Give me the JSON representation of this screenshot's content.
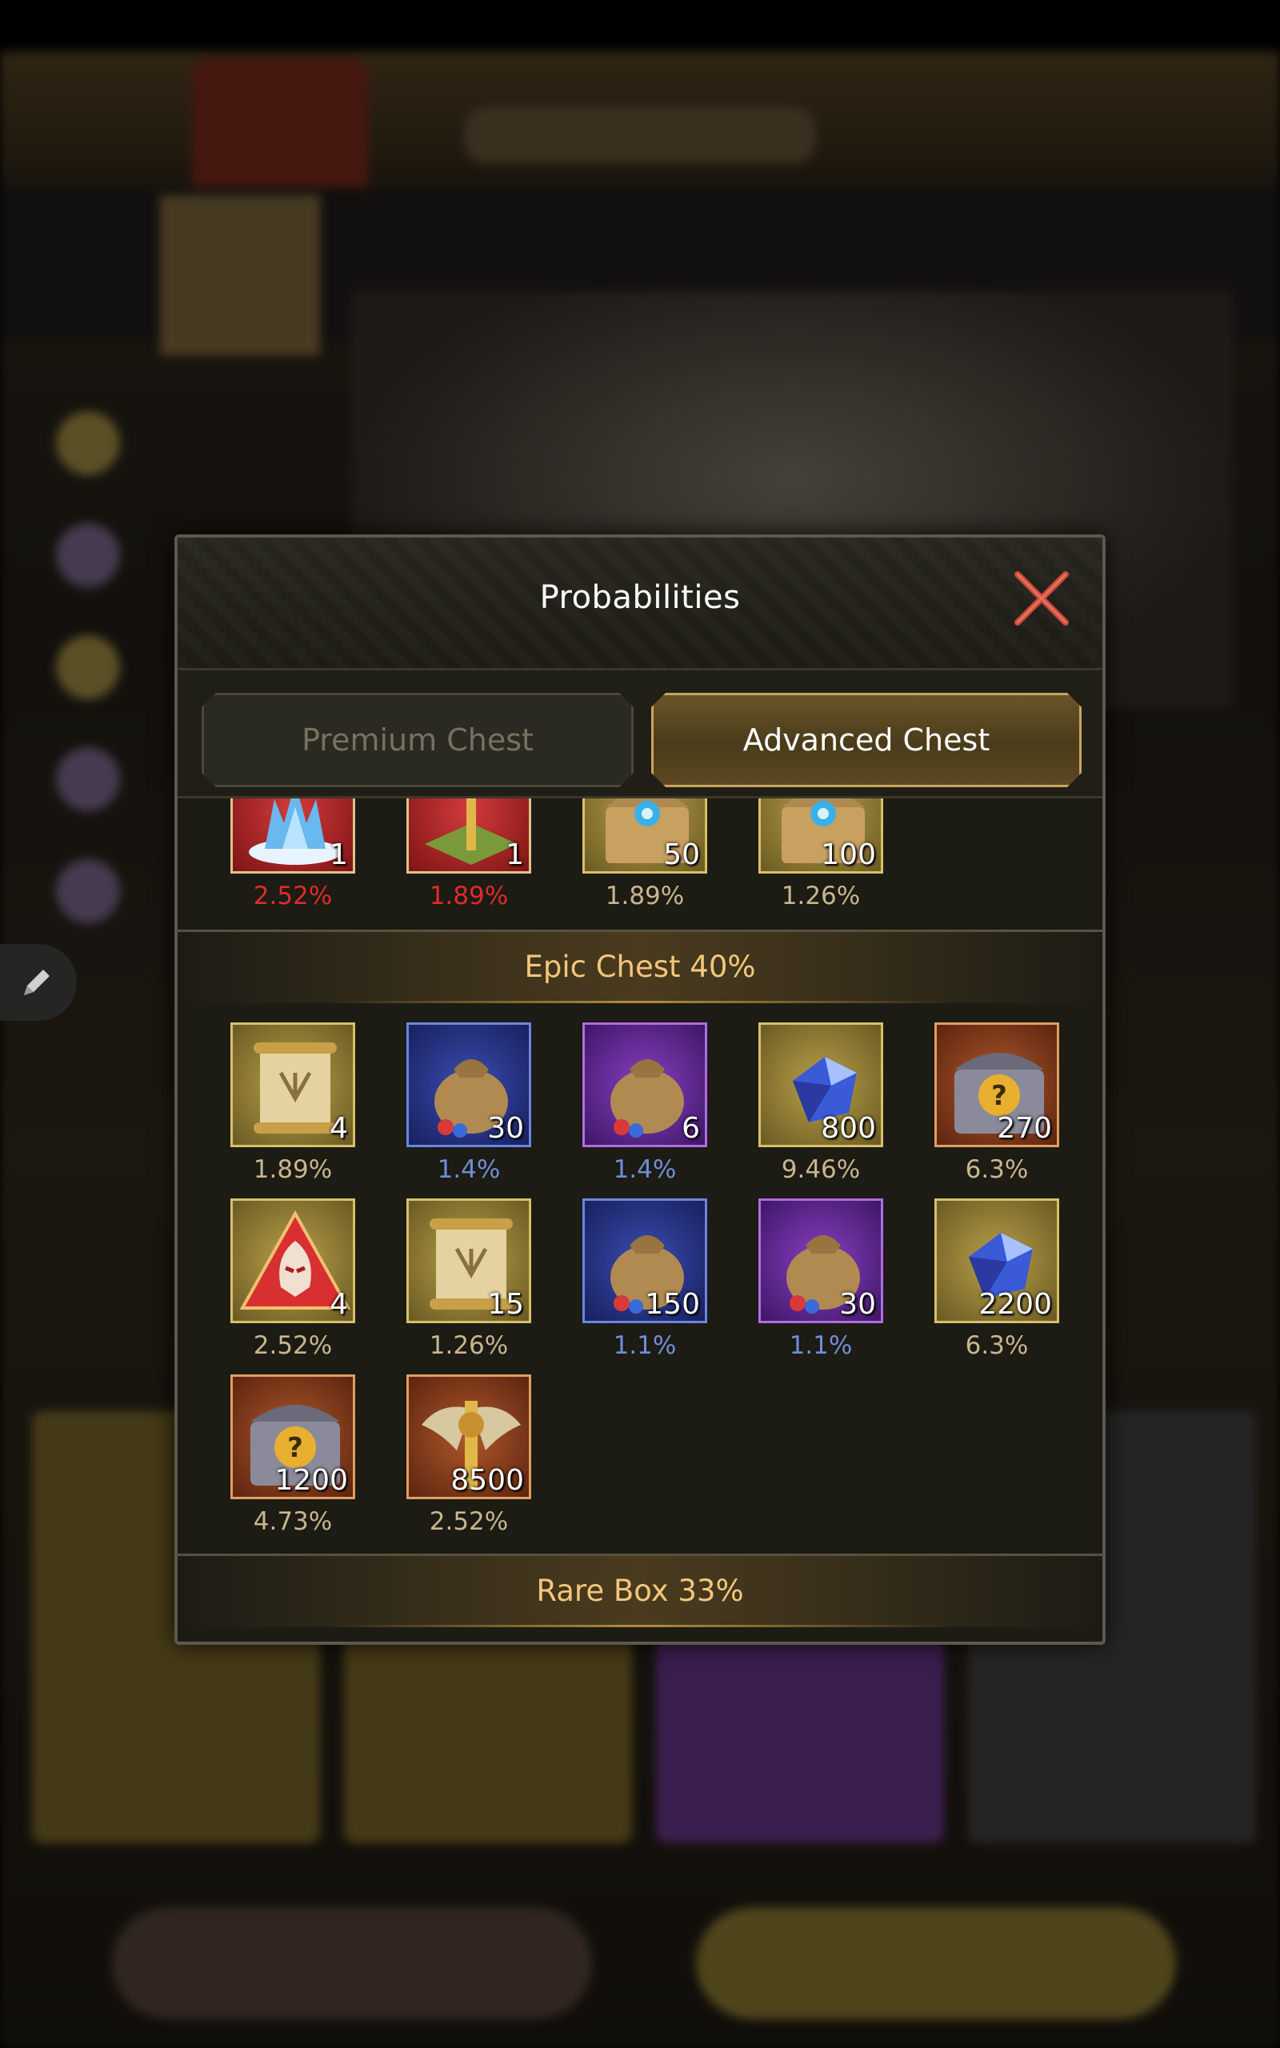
{
  "dialog": {
    "title": "Probabilities",
    "tabs": {
      "premium": "Premium Chest",
      "advanced": "Advanced Chest"
    },
    "active_tab": "advanced"
  },
  "top_row": [
    {
      "icon": "crystal-castle-icon",
      "qty": "1",
      "pct": "2.52%",
      "frame": "red",
      "pct_color": "#e02a2a"
    },
    {
      "icon": "golden-spire-icon",
      "qty": "1",
      "pct": "1.89%",
      "frame": "red",
      "pct_color": "#e02a2a"
    },
    {
      "icon": "treasure-chest-icon",
      "qty": "50",
      "pct": "1.89%",
      "frame": "gold",
      "pct_color": "#c9b58e"
    },
    {
      "icon": "treasure-chest-icon",
      "qty": "100",
      "pct": "1.26%",
      "frame": "gold",
      "pct_color": "#c9b58e"
    }
  ],
  "epic": {
    "title": "Epic Chest 40%",
    "items": [
      {
        "icon": "scroll-icon",
        "qty": "4",
        "pct": "1.89%",
        "frame": "gold"
      },
      {
        "icon": "resource-bag-icon",
        "qty": "30",
        "pct": "1.4%",
        "frame": "blue"
      },
      {
        "icon": "resource-bag-icon",
        "qty": "6",
        "pct": "1.4%",
        "frame": "purple"
      },
      {
        "icon": "blue-crystal-icon",
        "qty": "800",
        "pct": "9.46%",
        "frame": "gold"
      },
      {
        "icon": "mystery-chest-icon",
        "qty": "270",
        "pct": "6.3%",
        "frame": "orange"
      },
      {
        "icon": "red-mask-icon",
        "qty": "4",
        "pct": "2.52%",
        "frame": "gold"
      },
      {
        "icon": "scroll-icon",
        "qty": "15",
        "pct": "1.26%",
        "frame": "gold"
      },
      {
        "icon": "resource-bag-icon",
        "qty": "150",
        "pct": "1.1%",
        "frame": "blue"
      },
      {
        "icon": "resource-bag-icon",
        "qty": "30",
        "pct": "1.1%",
        "frame": "purple"
      },
      {
        "icon": "blue-crystal-icon",
        "qty": "2200",
        "pct": "6.3%",
        "frame": "gold"
      },
      {
        "icon": "mystery-chest-icon",
        "qty": "1200",
        "pct": "4.73%",
        "frame": "orange"
      },
      {
        "icon": "winged-emblem-icon",
        "qty": "8500",
        "pct": "2.52%",
        "frame": "orange"
      }
    ]
  },
  "rare": {
    "title": "Rare Box 33%"
  },
  "colors": {
    "accent_gold": "#c9a45e",
    "section_title": "#f3c77a",
    "close": "#c94a3a"
  }
}
